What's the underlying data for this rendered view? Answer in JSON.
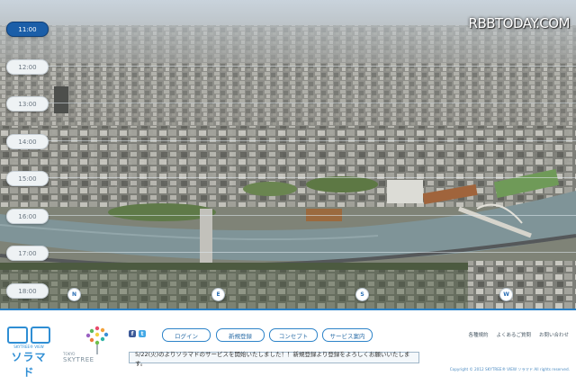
{
  "watermark": "RBBTODAY.COM",
  "time_slider": {
    "times": [
      "11:00",
      "12:00",
      "13:00",
      "14:00",
      "15:00",
      "16:00",
      "17:00",
      "18:00"
    ],
    "active": "11:00"
  },
  "compass": [
    "N",
    "E",
    "S",
    "W"
  ],
  "footer": {
    "logo": {
      "name": "ソラマド",
      "sub": "SKYTREE® VIEW"
    },
    "skytree_logo": {
      "small": "TOKYO",
      "big": "SKYTREE"
    },
    "social": {
      "facebook": "f",
      "twitter": "t"
    },
    "nav": [
      "ログイン",
      "新規登録",
      "コンセプト",
      "サービス案内"
    ],
    "news": "5/22(火)のよりソラマドのサービスを開始いたしました！！新規登録より登録をよろしくお願いいたします。",
    "links": [
      "各種規約",
      "よくあるご質問",
      "お問い合わせ"
    ],
    "copyright": "Copyright © 2012 SKYTREE® VIEW ソラマド All rights reserved."
  },
  "colors": {
    "accent": "#1b5ea8",
    "brand": "#2f8ed4",
    "river": "#7f9498"
  }
}
